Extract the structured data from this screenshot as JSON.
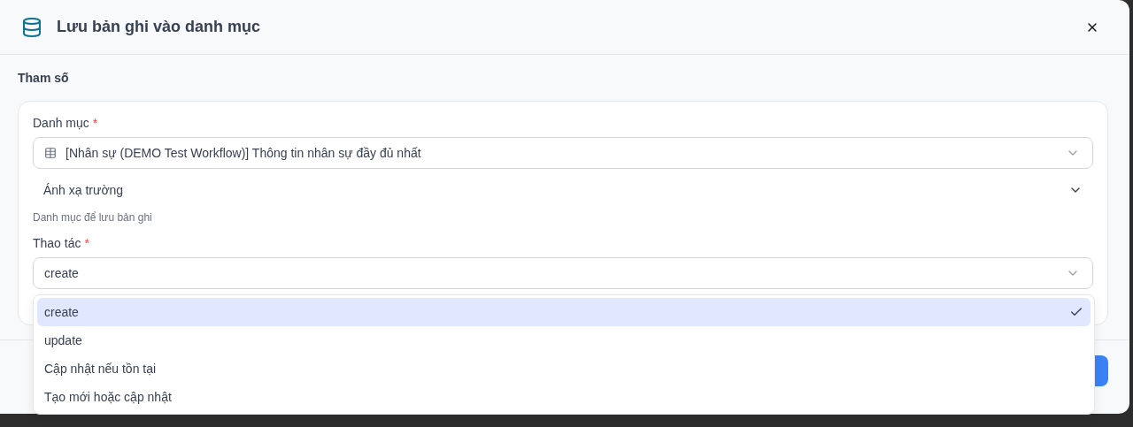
{
  "dialog": {
    "title": "Lưu bản ghi vào danh mục"
  },
  "section": {
    "title": "Tham số"
  },
  "catalog_field": {
    "label": "Danh mục",
    "required_mark": "*",
    "value": "[Nhân sự (DEMO Test Workflow)] Thông tin nhân sự đầy đủ nhất"
  },
  "mapping": {
    "label": "Ánh xạ trường",
    "expanded": false
  },
  "catalog_hint": "Danh mục để lưu bản ghi",
  "action_field": {
    "label": "Thao tác",
    "required_mark": "*",
    "value": "create",
    "open": true
  },
  "options": [
    {
      "label": "create",
      "selected": true
    },
    {
      "label": "update",
      "selected": false
    },
    {
      "label": "Cập nhật nếu tồn tại",
      "selected": false
    },
    {
      "label": "Tạo mới hoặc cập nhật",
      "selected": false
    }
  ]
}
